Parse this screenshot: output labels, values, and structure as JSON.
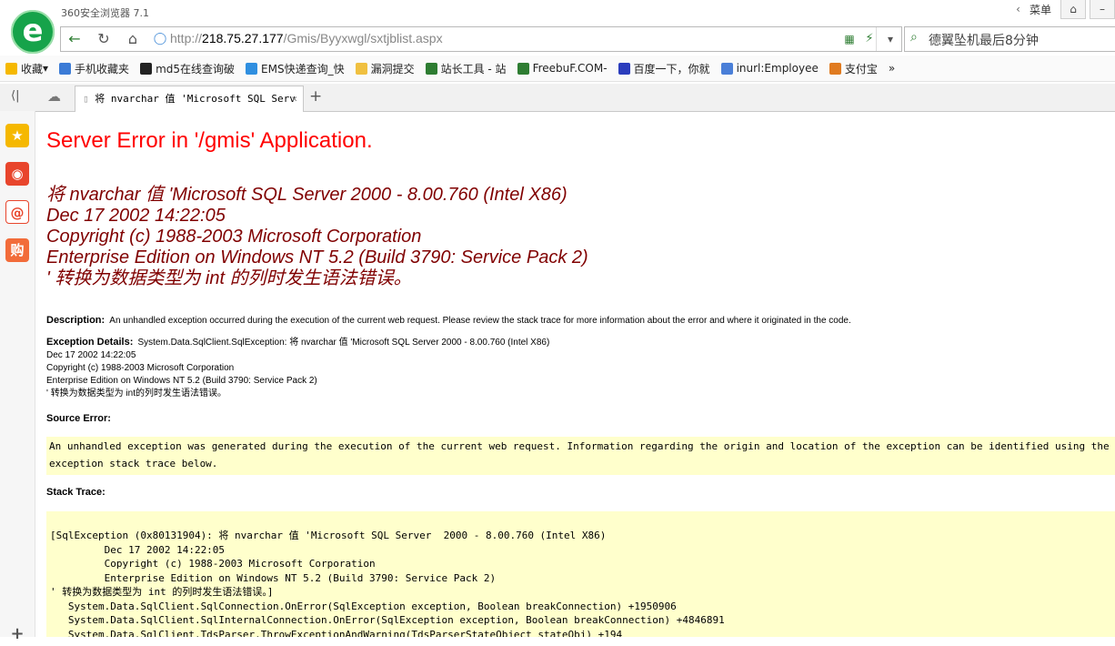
{
  "browser": {
    "app_title": "360安全浏览器 7.1",
    "menu_label": "菜单",
    "url_prefix": "http://",
    "url_host": "218.75.27.177",
    "url_path": "/Gmis/Byyxwgl/sxtjblist.aspx",
    "search_text": "德翼坠机最后8分钟",
    "bookmarks": [
      "收藏",
      "手机收藏夹",
      "md5在线查询破",
      "EMS快递查询_快",
      "漏洞提交",
      "站长工具 - 站",
      "FreebuF.COM-",
      "百度一下，你就",
      "inurl:Employee",
      "支付宝"
    ],
    "tab_title": "将 nvarchar 值 'Microsoft SQL Serv",
    "colors": {
      "accent": "#2e7d32",
      "error_red": "#ff0000",
      "error_maroon": "#800000",
      "code_bg": "#ffffcc"
    }
  },
  "page": {
    "title": "Server Error in '/gmis' Application.",
    "error_lines": [
      "将 nvarchar 值 'Microsoft SQL Server  2000 - 8.00.760 (Intel X86)",
      "Dec 17 2002 14:22:05",
      "Copyright (c) 1988-2003 Microsoft Corporation",
      "Enterprise Edition on Windows NT 5.2 (Build 3790: Service Pack 2)",
      "' 转换为数据类型为 int 的列时发生语法错误。"
    ],
    "description_label": "Description:",
    "description_text": "An unhandled exception occurred during the execution of the current web request. Please review the stack trace for more information about the error and where it originated in the code.",
    "exception_label": "Exception Details:",
    "exception_first": "System.Data.SqlClient.SqlException: 将 nvarchar 值 'Microsoft SQL Server  2000 - 8.00.760 (Intel X86)",
    "exception_lines": [
      "Dec 17 2002 14:22:05",
      "Copyright (c) 1988-2003 Microsoft Corporation",
      "Enterprise Edition on Windows NT 5.2 (Build 3790: Service Pack 2)",
      "' 转换为数据类型为 int的列时发生语法错误。"
    ],
    "source_error_label": "Source Error:",
    "source_error_text": "An unhandled exception was generated during the execution of the current web request. Information regarding the origin and location of the exception can be identified using the exception stack trace below.",
    "stack_trace_label": "Stack Trace:",
    "stack_lines": [
      "[SqlException (0x80131904): 将 nvarchar 值 'Microsoft SQL Server  2000 - 8.00.760 (Intel X86)",
      "         Dec 17 2002 14:22:05",
      "         Copyright (c) 1988-2003 Microsoft Corporation",
      "         Enterprise Edition on Windows NT 5.2 (Build 3790: Service Pack 2)",
      "' 转换为数据类型为 int 的列时发生语法错误。]",
      "   System.Data.SqlClient.SqlConnection.OnError(SqlException exception, Boolean breakConnection) +1950906",
      "   System.Data.SqlClient.SqlInternalConnection.OnError(SqlException exception, Boolean breakConnection) +4846891",
      "   System.Data.SqlClient.TdsParser.ThrowExceptionAndWarning(TdsParserStateObject stateObj) +194"
    ]
  }
}
